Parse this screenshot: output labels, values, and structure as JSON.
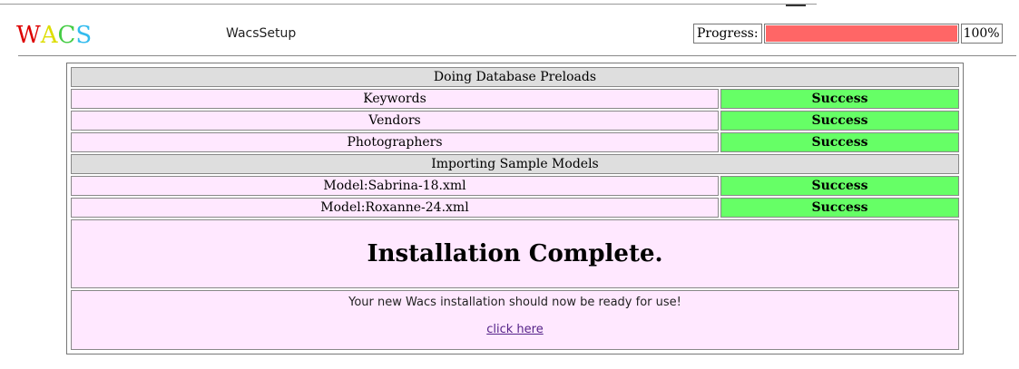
{
  "header": {
    "logo_letters": [
      {
        "char": "W",
        "color": "#dd0000"
      },
      {
        "char": "A",
        "color": "#dddd00"
      },
      {
        "char": "C",
        "color": "#44cc44"
      },
      {
        "char": "S",
        "color": "#33bbee"
      }
    ],
    "app_name": "WacsSetup",
    "progress_label": "Progress:",
    "progress_value": 100,
    "progress_text": "100%",
    "progress_color": "#ff6666"
  },
  "sections": [
    {
      "title": "Doing Database Preloads",
      "rows": [
        {
          "label": "Keywords",
          "status": "Success"
        },
        {
          "label": "Vendors",
          "status": "Success"
        },
        {
          "label": "Photographers",
          "status": "Success"
        }
      ]
    },
    {
      "title": "Importing Sample Models",
      "rows": [
        {
          "label": "Model:Sabrina-18.xml",
          "status": "Success"
        },
        {
          "label": "Model:Roxanne-24.xml",
          "status": "Success"
        }
      ]
    }
  ],
  "completion": {
    "heading": "Installation Complete.",
    "message": "Your new Wacs installation should now be ready for use!",
    "link_text": "click here"
  },
  "colors": {
    "section_bg": "#dedede",
    "item_bg": "#ffe8ff",
    "success_bg": "#66ff66"
  }
}
